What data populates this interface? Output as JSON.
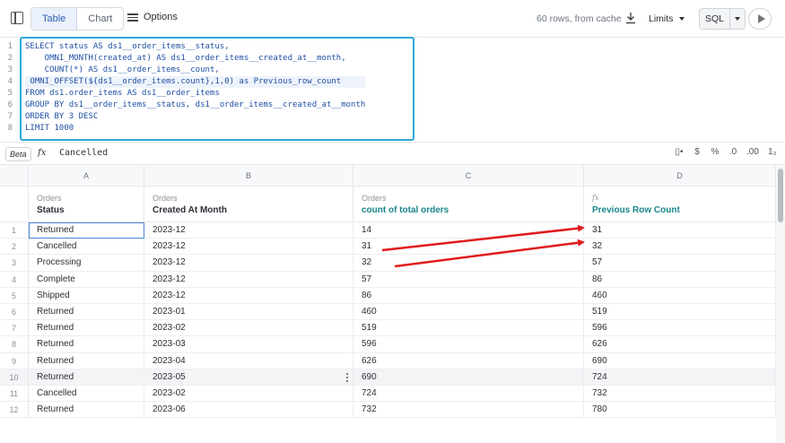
{
  "toolbar": {
    "tabs": [
      {
        "label": "Table",
        "active": true
      },
      {
        "label": "Chart",
        "active": false
      }
    ],
    "options_label": "Options",
    "rows_info": "60 rows, from cache",
    "limits_label": "Limits",
    "sql_label": "SQL"
  },
  "editor": {
    "line_numbers": [
      "1",
      "2",
      "3",
      "4",
      "5",
      "6",
      "7",
      "8"
    ],
    "lines": [
      "SELECT status AS ds1__order_items__status,",
      "    OMNI_MONTH(created_at) AS ds1__order_items__created_at__month,",
      "    COUNT(*) AS ds1__order_items__count,",
      " OMNI_OFFSET(${ds1__order_items.count},1,0) as Previous_row_count",
      "FROM ds1.order_items AS ds1__order_items",
      "GROUP BY ds1__order_items__status, ds1__order_items__created_at__month",
      "ORDER BY 3 DESC",
      "LIMIT 1000"
    ]
  },
  "formula_bar": {
    "beta_label": "Beta",
    "fx_label": "fx",
    "value": "Cancelled",
    "format_icons": [
      "▯•",
      "$",
      "%",
      ".0",
      ".00",
      "1₂"
    ]
  },
  "grid": {
    "column_letters": [
      "A",
      "B",
      "C",
      "D"
    ],
    "headers": [
      {
        "view": "Orders",
        "name": "Status"
      },
      {
        "view": "Orders",
        "name": "Created At Month"
      },
      {
        "view": "Orders",
        "name": "count of total orders"
      },
      {
        "view": "fx",
        "name": "Previous Row Count"
      }
    ],
    "rows": [
      {
        "n": "1",
        "status": "Returned",
        "month": "2023-12",
        "count": "14",
        "prev": "31"
      },
      {
        "n": "2",
        "status": "Cancelled",
        "month": "2023-12",
        "count": "31",
        "prev": "32"
      },
      {
        "n": "3",
        "status": "Processing",
        "month": "2023-12",
        "count": "32",
        "prev": "57"
      },
      {
        "n": "4",
        "status": "Complete",
        "month": "2023-12",
        "count": "57",
        "prev": "86"
      },
      {
        "n": "5",
        "status": "Shipped",
        "month": "2023-12",
        "count": "86",
        "prev": "460"
      },
      {
        "n": "6",
        "status": "Returned",
        "month": "2023-01",
        "count": "460",
        "prev": "519"
      },
      {
        "n": "7",
        "status": "Returned",
        "month": "2023-02",
        "count": "519",
        "prev": "596"
      },
      {
        "n": "8",
        "status": "Returned",
        "month": "2023-03",
        "count": "596",
        "prev": "626"
      },
      {
        "n": "9",
        "status": "Returned",
        "month": "2023-04",
        "count": "626",
        "prev": "690"
      },
      {
        "n": "10",
        "status": "Returned",
        "month": "2023-05",
        "count": "690",
        "prev": "724"
      },
      {
        "n": "11",
        "status": "Cancelled",
        "month": "2023-02",
        "count": "724",
        "prev": "732"
      },
      {
        "n": "12",
        "status": "Returned",
        "month": "2023-06",
        "count": "732",
        "prev": "780"
      }
    ]
  },
  "colors": {
    "accent": "#2f63b5",
    "highlight_box": "#2fa8d8",
    "annotation_arrow": "#e01b1b",
    "calc_header": "#18868a"
  }
}
